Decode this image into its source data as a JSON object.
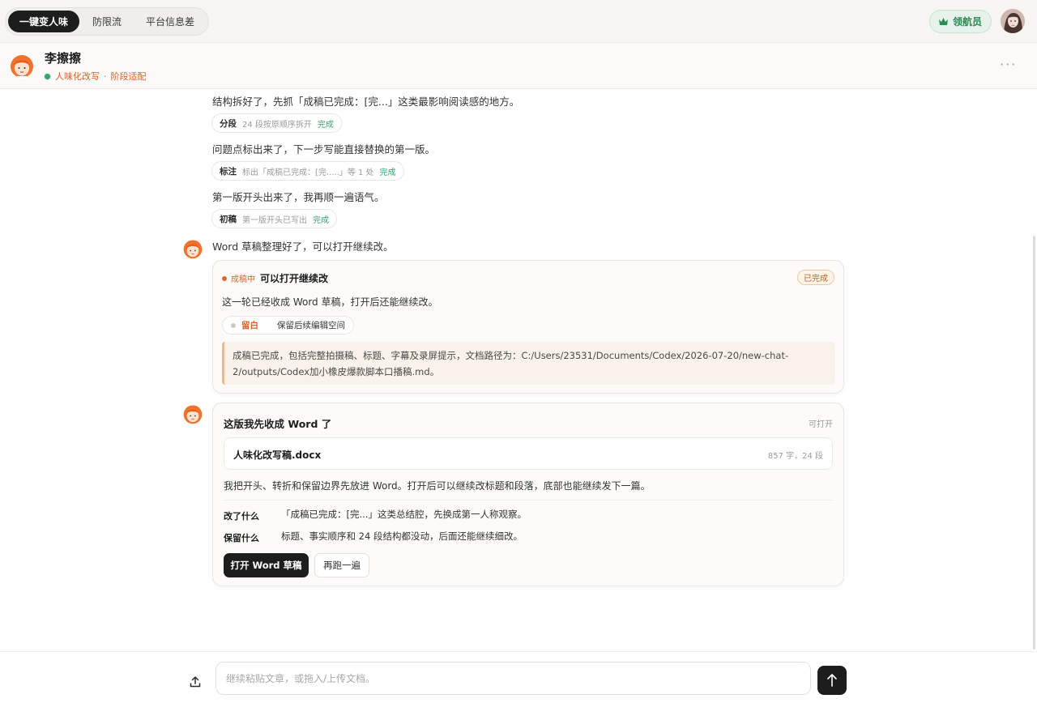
{
  "topnav": {
    "tabs": [
      "一键变人味",
      "防限流",
      "平台信息差"
    ],
    "vip_label": "领航员"
  },
  "chat_header": {
    "name": "李擦擦",
    "status_mode": "人味化改写",
    "status_stage": "阶段适配",
    "more": "···"
  },
  "messages": {
    "m1": "结构拆好了，先抓「成稿已完成：[完...」这类最影响阅读感的地方。",
    "chip1": {
      "k": "分段",
      "desc": "24 段按原顺序拆开",
      "status": "完成"
    },
    "m2": "问题点标出来了，下一步写能直接替换的第一版。",
    "chip2": {
      "k": "标注",
      "desc": "标出「成稿已完成：[完.....」等 1 处",
      "status": "完成"
    },
    "m3": "第一版开头出来了，我再顺一遍语气。",
    "chip3": {
      "k": "初稿",
      "desc": "第一版开头已写出",
      "status": "完成"
    },
    "m4": "Word 草稿整理好了，可以打开继续改。"
  },
  "card1": {
    "state": "成稿中",
    "title": "可以打开继续改",
    "done": "已完成",
    "line": "这一轮已经收成 Word 草稿，打开后还能继续改。",
    "reserve_k": "留白",
    "reserve_v": "保留后续编辑空间",
    "quote_line1": "成稿已完成，包括完整拍摄稿、标题、字幕及录屏提示，文档路径为：C:/Users/23531/Documents/Codex/2026-07-20/new-chat-",
    "quote_line2": "2/outputs/Codex加小橡皮爆款脚本口播稿.md。"
  },
  "card2": {
    "title": "这版我先收成 Word 了",
    "open_hint": "可打开",
    "file_name": "人味化改写稿.docx",
    "file_meta": "857 字，24 段",
    "desc": "我把开头、转折和保留边界先放进 Word。打开后可以继续改标题和段落，底部也能继续发下一篇。",
    "changed_k": "改了什么",
    "changed_v": "「成稿已完成：[完...」这类总结腔，先换成第一人称观察。",
    "kept_k": "保留什么",
    "kept_v": "标题、事实顺序和 24 段结构都没动，后面还能继续细改。",
    "btn_open": "打开 Word 草稿",
    "btn_rerun": "再跑一遍"
  },
  "composer": {
    "placeholder": "继续粘贴文章，或拖入/上传文档。"
  }
}
